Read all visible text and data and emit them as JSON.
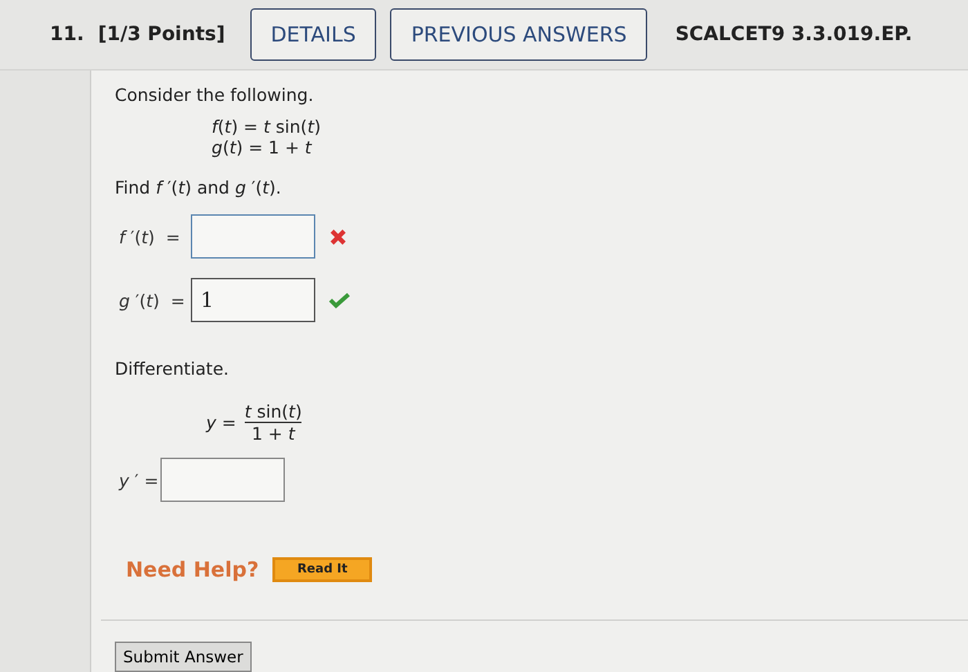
{
  "question": {
    "number": "11.",
    "points": "[1/3 Points]",
    "buttons": [
      "DETAILS",
      "PREVIOUS ANSWERS"
    ],
    "code": "SCALCET9 3.3.019.EP."
  },
  "part1": {
    "intro": "Consider the following.",
    "equations": [
      "*f*(*t*) = *t* sin(*t*)",
      "*g*(*t*) = 1 + *t*"
    ],
    "prompt": "Find *f* ′(*t*) and *g* ′(*t*).",
    "answers": [
      {
        "label": "*f* ′(*t*)  =",
        "correct": false
      },
      {
        "label": "*g* ′(*t*)  =",
        "value": "1",
        "correct": true
      }
    ]
  },
  "part2": {
    "intro": "Differentiate.",
    "lhs": "*y* =",
    "numerator": "*t* sin(*t*)",
    "denominator": "1 + *t*",
    "answers": [
      {
        "label": "*y* ′ ="
      }
    ]
  },
  "help": {
    "label": "Need Help?",
    "button": "Read It"
  },
  "submit": "Submit Answer"
}
